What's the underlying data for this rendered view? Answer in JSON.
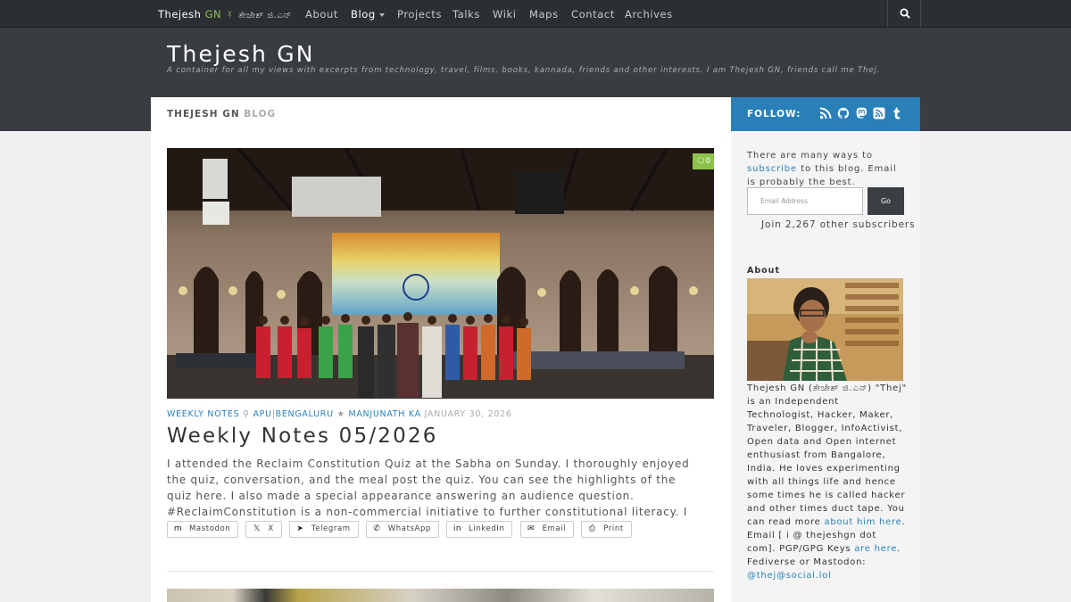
{
  "nav": {
    "brand_name": "Thejesh",
    "brand_gn": "GN",
    "brand_sep": "ᛡ",
    "brand_kannada": "ತೇಜೇಶ್ ಜಿ.ಎನ್",
    "items": [
      "About",
      "Blog",
      "Projects",
      "Talks",
      "Wiki",
      "Maps",
      "Contact",
      "Archives"
    ],
    "search_icon": "search-icon"
  },
  "header": {
    "title": "Thejesh GN",
    "tagline": "A container for all my views with excerpts from technology, travel, films, books, kannada, friends and other interests. I am Thejesh GN, friends call me Thej."
  },
  "blogbar": {
    "bold": "THEJESH GN",
    "light": "BLOG"
  },
  "follow": {
    "label": "FOLLOW:",
    "icons": [
      "rss-icon",
      "github-icon",
      "mastodon-icon",
      "feed-icon",
      "tumblr-icon"
    ]
  },
  "post": {
    "comment_count": "0",
    "meta": {
      "category": "WEEKLY NOTES",
      "location_1": "APU",
      "location_sep": "|",
      "location_2": "BENGALURU",
      "author": "MANJUNATH KA",
      "date": "JANUARY 30, 2026"
    },
    "title": "Weekly Notes 05/2026",
    "excerpt": "I attended the Reclaim Constitution Quiz at the Sabha on Sunday. I thoroughly enjoyed the quiz, conversation, and the meal post the quiz. You can see the highlights of the quiz here. I also made a special appearance answering an audience question. #ReclaimConstitution is a non-commercial initiative to further constitutional literacy. I love…",
    "share": [
      {
        "label": "Mastodon",
        "icon": "mastodon-icon",
        "glyph": "m"
      },
      {
        "label": "X",
        "icon": "x-icon",
        "glyph": "𝕏"
      },
      {
        "label": "Telegram",
        "icon": "telegram-icon",
        "glyph": "➤"
      },
      {
        "label": "WhatsApp",
        "icon": "whatsapp-icon",
        "glyph": "✆"
      },
      {
        "label": "LinkedIn",
        "icon": "linkedin-icon",
        "glyph": "in"
      },
      {
        "label": "Email",
        "icon": "email-icon",
        "glyph": "✉"
      },
      {
        "label": "Print",
        "icon": "print-icon",
        "glyph": "⎙"
      }
    ]
  },
  "sidebar": {
    "sub_text_1": "There are many ways to",
    "sub_link": "subscribe",
    "sub_text_2": "to this blog. Email is probably the best.",
    "email_placeholder": "Email Address",
    "go_label": "Go",
    "join_text": "Join 2,267 other subscribers",
    "about_heading": "About",
    "about_text_1": "Thejesh GN (ತೇಜೇಶ್ ಜಿ.ಎನ್) \"Thej\" is an Independent Technologist, Hacker, Maker, Traveler, Blogger, InfoActivist, Open data and Open internet enthusiast from Bangalore, India. He loves experimenting with all things life and hence some times he is called hacker and other times duct tape. You can read more",
    "about_link_1": "about him here",
    "about_text_2": ". Email [ i @ thejeshgn dot com]. PGP/GPG Keys",
    "about_link_2": "are here",
    "about_text_3": ".",
    "about_text_4": "Fediverse or Mastodon:",
    "about_link_3": "@thej@social.lol"
  },
  "colors": {
    "accent": "#2980b9",
    "green": "#8bc34a",
    "nav_bg": "#2b2e33",
    "header_bg": "#393c41"
  }
}
